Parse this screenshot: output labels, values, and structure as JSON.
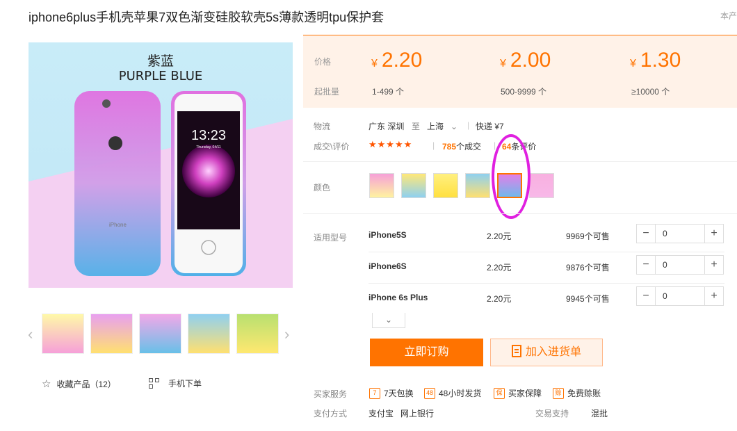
{
  "product": {
    "title": "iphone6plus手机壳苹果7双色渐变硅胶软壳5s薄款透明tpu保护套",
    "top_right": "本产"
  },
  "main_image": {
    "label_cn": "紫蓝",
    "label_en": "PURPLE BLUE",
    "phone_time": "13:23",
    "phone_date": "Thursday, 04/11",
    "phone_brand": "iPhone"
  },
  "gallery": {
    "thumbnails": [
      "yellow-pink",
      "purple-yellow",
      "pink-blue",
      "blue-yellow",
      "green-yellow"
    ],
    "prev_icon": "chevron-left-icon",
    "next_icon": "chevron-right-icon"
  },
  "actions": {
    "favorite_label": "收藏产品（12）",
    "mobile_label": "手机下单"
  },
  "pricing": {
    "price_label": "价格",
    "moq_label": "起批量",
    "currency": "¥",
    "tiers": [
      {
        "price": "2.20",
        "range": "1-499 个"
      },
      {
        "price": "2.00",
        "range": "500-9999 个"
      },
      {
        "price": "1.30",
        "range": "≥10000 个"
      }
    ]
  },
  "logistics": {
    "label": "物流",
    "from": "广东 深圳",
    "to_word": "至",
    "dest": "上海",
    "express": "快递 ¥7"
  },
  "deals": {
    "label": "成交\\评价",
    "rating": 5,
    "stars": "★★★★★",
    "sold_count": "785",
    "sold_suffix": "个成交",
    "review_count": "64",
    "review_suffix": "条评价"
  },
  "color": {
    "label": "颜色",
    "swatches": [
      "pink-yellow",
      "yellow-blue",
      "yellow",
      "blue-yellow",
      "purple-blue",
      "pink-pink"
    ],
    "selected_index": 4
  },
  "models": {
    "label": "适用型号",
    "rows": [
      {
        "name": "iPhone5S",
        "price": "2.20元",
        "stock": "9969个可售",
        "qty": "0"
      },
      {
        "name": "iPhone6S",
        "price": "2.20元",
        "stock": "9876个可售",
        "qty": "0"
      },
      {
        "name": "iPhone 6s Plus",
        "price": "2.20元",
        "stock": "9945个可售",
        "qty": "0"
      }
    ],
    "minus": "−",
    "plus": "+",
    "expand": "⌄"
  },
  "buttons": {
    "buy": "立即订购",
    "cart": "加入进货单"
  },
  "services": {
    "label": "买家服务",
    "items": [
      {
        "icon": "7",
        "text": "7天包换"
      },
      {
        "icon": "48",
        "text": "48小时发货"
      },
      {
        "icon": "保",
        "text": "买家保障"
      },
      {
        "icon": "赊",
        "text": "免费赊账"
      }
    ]
  },
  "payment": {
    "label": "支付方式",
    "alipay": "支付宝",
    "bank": "网上银行",
    "trade_support_label": "交易支持",
    "trade_support_value": "混批"
  },
  "colors": {
    "accent": "#ff7300",
    "price_bg": "#fff2e8",
    "highlight_circle": "#e020e0"
  }
}
